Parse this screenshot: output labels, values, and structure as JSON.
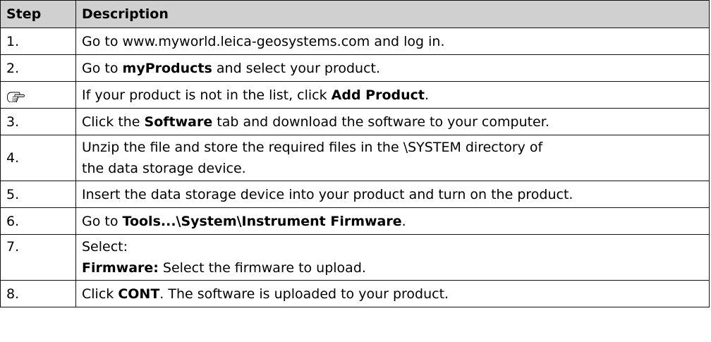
{
  "header": {
    "step": "Step",
    "description": "Description"
  },
  "rows": [
    {
      "step": "1.",
      "parts": [
        "Go to www.myworld.leica-geosystems.com and log in."
      ]
    },
    {
      "step": "2.",
      "parts": [
        "Go to ",
        "myProducts",
        " and select your product."
      ]
    },
    {
      "step_icon": "pointing-hand-icon",
      "parts": [
        "If your product is not in the list, click ",
        "Add Product",
        "."
      ]
    },
    {
      "step": "3.",
      "parts": [
        "Click the ",
        "Software",
        " tab and download the software to your computer."
      ]
    },
    {
      "step": "4.",
      "lines": [
        "Unzip the file and store the required files in the \\SYSTEM directory of",
        "the data storage device."
      ]
    },
    {
      "step": "5.",
      "parts": [
        "Insert the data storage device into your product and turn on the product."
      ]
    },
    {
      "step": "6.",
      "parts": [
        "Go to ",
        "Tools...\\System\\Instrument Firmware",
        "."
      ]
    },
    {
      "step": "7.",
      "line1": "Select:",
      "line2_bold": "Firmware:",
      "line2_rest": " Select the firmware to upload."
    },
    {
      "step": "8.",
      "parts": [
        "Click ",
        "CONT",
        ". The software is uploaded to your product."
      ]
    }
  ]
}
